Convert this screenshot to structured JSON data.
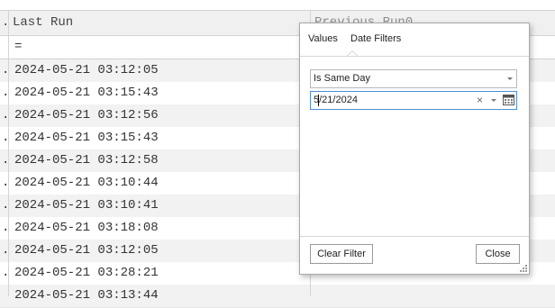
{
  "grid": {
    "header": {
      "left_col_fragment": ".",
      "last_run_label": "Last Run",
      "previous_run_label": "Previous Run0"
    },
    "filter_row": {
      "operator": "="
    },
    "rows": [
      {
        "marker": ".",
        "last_run": "2024-05-21 03:12:05"
      },
      {
        "marker": ".",
        "last_run": "2024-05-21 03:15:43"
      },
      {
        "marker": ".",
        "last_run": "2024-05-21 03:12:56"
      },
      {
        "marker": ".",
        "last_run": "2024-05-21 03:15:43"
      },
      {
        "marker": ".",
        "last_run": "2024-05-21 03:12:58"
      },
      {
        "marker": ".",
        "last_run": "2024-05-21 03:10:44"
      },
      {
        "marker": ".",
        "last_run": "2024-05-21 03:10:41"
      },
      {
        "marker": ".",
        "last_run": "2024-05-21 03:18:08"
      },
      {
        "marker": ".",
        "last_run": "2024-05-21 03:12:05"
      },
      {
        "marker": ".",
        "last_run": "2024-05-21 03:28:21"
      },
      {
        "marker": "",
        "last_run": "2024-05-21 03:13:44"
      }
    ]
  },
  "popup": {
    "tabs": [
      {
        "label": "Values",
        "active": false
      },
      {
        "label": "Date Filters",
        "active": true
      }
    ],
    "condition": {
      "selected": "Is Same Day"
    },
    "date_value": "5/21/2024",
    "clear_symbol": "×",
    "buttons": {
      "clear_filter": "Clear Filter",
      "close": "Close"
    }
  },
  "colors": {
    "header_bg": "#f0f0f0",
    "row_alt": "#f2f2f2",
    "focus_border": "#4a90d9",
    "funnel": "#2f6fbf"
  },
  "icons": {
    "filter": "funnel-icon",
    "calendar": "calendar-icon",
    "resize": "resize-grip-icon"
  }
}
